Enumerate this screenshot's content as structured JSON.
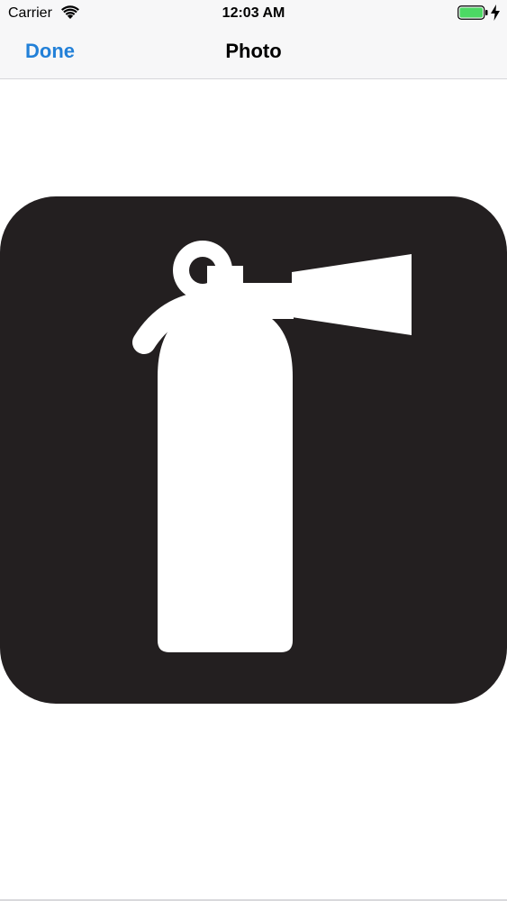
{
  "status_bar": {
    "carrier": "Carrier",
    "time": "12:03 AM",
    "wifi_icon": "wifi-icon",
    "battery_icon": "battery-icon",
    "battery_color": "#4cd964",
    "charging_icon": "bolt-icon"
  },
  "nav_bar": {
    "done_label": "Done",
    "title": "Photo",
    "accent_color": "#2280d8"
  },
  "photo": {
    "subject_icon": "fire-extinguisher-icon",
    "background_color": "#231f20",
    "foreground_color": "#ffffff"
  }
}
